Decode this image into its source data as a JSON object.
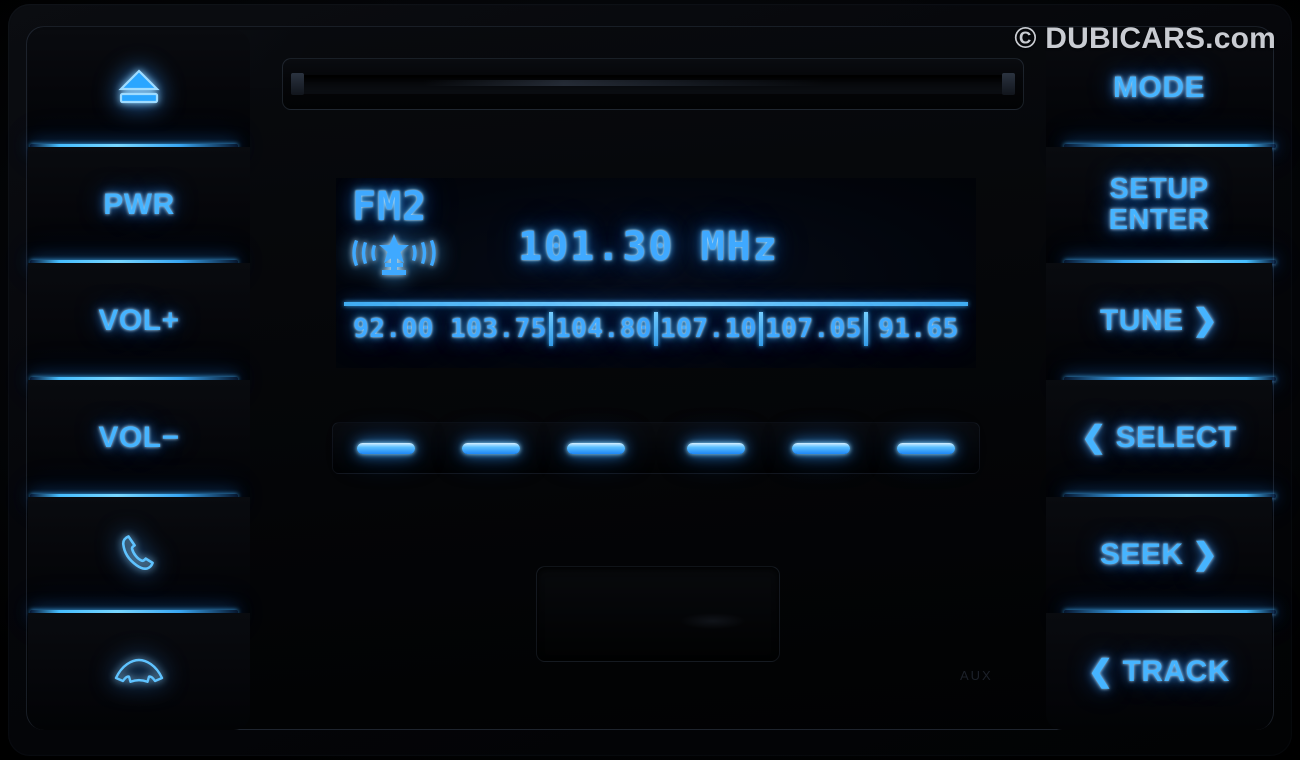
{
  "watermark": {
    "text": "© DUBICARS.com"
  },
  "left_buttons": [
    {
      "name": "eject",
      "label": "",
      "icon": "eject-icon"
    },
    {
      "name": "power",
      "label": "PWR",
      "icon": ""
    },
    {
      "name": "volume-up",
      "label": "VOL+",
      "icon": ""
    },
    {
      "name": "volume-down",
      "label": "VOL−",
      "icon": ""
    },
    {
      "name": "phone-call",
      "label": "",
      "icon": "phone-handset-icon"
    },
    {
      "name": "phone-hangup",
      "label": "",
      "icon": "phone-hangup-icon"
    }
  ],
  "right_buttons": [
    {
      "name": "mode",
      "label": "MODE"
    },
    {
      "name": "setup-enter",
      "label": "SETUP\nENTER"
    },
    {
      "name": "tune",
      "label": "TUNE ❯"
    },
    {
      "name": "select",
      "label": "❮ SELECT"
    },
    {
      "name": "seek",
      "label": "SEEK ❯"
    },
    {
      "name": "track",
      "label": "❮ TRACK"
    }
  ],
  "display": {
    "band": "FM2",
    "signal_icon": "radio-broadcast-icon",
    "frequency": "101.30",
    "unit": "MHz",
    "frequency_line": "101.30  MHz",
    "presets": [
      "92.00",
      "103.75",
      "104.80",
      "107.10",
      "107.05",
      "91.65"
    ]
  },
  "preset_buttons": [
    {
      "index": 1,
      "label": ""
    },
    {
      "index": 2,
      "label": ""
    },
    {
      "index": 3,
      "label": ""
    },
    {
      "index": 4,
      "label": ""
    },
    {
      "index": 5,
      "label": ""
    },
    {
      "index": 6,
      "label": ""
    }
  ],
  "faint_label": {
    "text": "AUX"
  },
  "colors": {
    "accent_blue": "#46b4ff",
    "vfd_blue": "#3fa9ff",
    "glow_blue": "#1d86f5",
    "body_black": "#05060a",
    "watermark_grey": "#c9ccd2"
  }
}
